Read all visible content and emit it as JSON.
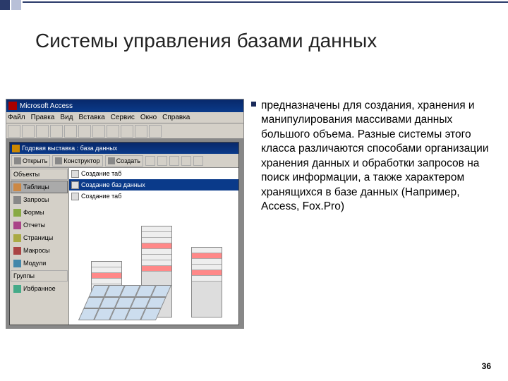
{
  "slide": {
    "title": "Системы управления базами данных",
    "body": "предназначены для создания, хранения и манипулирования массивами данных большого объема. Разные системы этого класса различаются способами организации хранения данных и обработки запросов на поиск информации, а также характером хранящихся в базе данных (Например, Access, Fox.Pro)",
    "page_number": "36"
  },
  "app": {
    "title": "Microsoft Access",
    "menus": [
      "Файл",
      "Правка",
      "Вид",
      "Вставка",
      "Сервис",
      "Окно",
      "Справка"
    ],
    "db_window_title": "Годовая выставка : база данных",
    "db_toolbar": {
      "open": "Открыть",
      "design": "Конструктор",
      "create": "Создать"
    },
    "sidebar": {
      "objects_header": "Объекты",
      "items": [
        "Таблицы",
        "Запросы",
        "Формы",
        "Отчеты",
        "Страницы",
        "Макросы",
        "Модули"
      ],
      "groups_header": "Группы",
      "favorites": "Избранное"
    },
    "content_rows": [
      "Создание таб",
      "Создание таб",
      "Создание таб"
    ],
    "overlay_title": "Создание баз данных"
  }
}
